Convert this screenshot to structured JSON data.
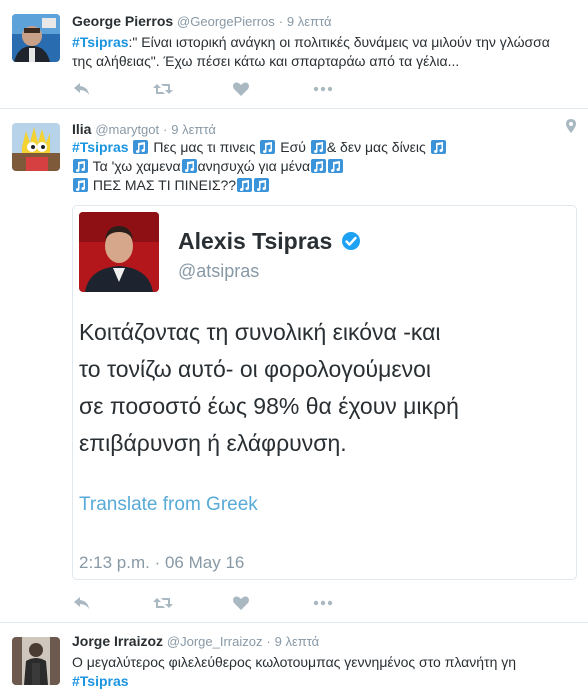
{
  "tweets": [
    {
      "name": "George Pierros",
      "handle": "@GeorgePierros",
      "separator": "·",
      "time": "9 λεπτά",
      "line1_tag": "#Tsipras",
      "line1_rest": ":\" Είναι ιστορική ανάγκη οι πολιτικές δυνάμεις να μιλούν την γλώσσα",
      "line2": "της αλήθειας\". Έχω πέσει κάτω και σπαρταράω από τα γέλια..."
    },
    {
      "name": "Ilia",
      "handle": "@marytgot",
      "separator": "·",
      "time": "9 λεπτά",
      "line1_tag": "#Tsipras",
      "line1_a": "Πες μας τι πινεις",
      "line1_b": "Εσύ",
      "line1_c": "& δεν μας δίνεις",
      "line2": "Τα 'χω χαμενα",
      "line2_b": "ανησυχώ για μένα",
      "line3": "ΠΕΣ ΜΑΣ ΤΙ ΠΙΝΕΙΣ??",
      "quoted": {
        "name": "Alexis Tsipras",
        "handle": "@atsipras",
        "text_lines": [
          "Κοιτάζοντας τη συνολική εικόνα -και",
          "το τονίζω αυτό- οι φορολογούμενοι",
          "σε ποσοστό έως 98% θα έχουν μικρή",
          "επιβάρυνση ή ελάφρυνση."
        ],
        "translate": "Translate from Greek",
        "timestamp": "2:13 p.m. · 06 May 16"
      }
    },
    {
      "name": "Jorge Irraizoz",
      "handle": "@Jorge_Irraizoz",
      "separator": "·",
      "time": "9 λεπτά",
      "line1": "Ο μεγαλύτερος φιλελεύθερος κωλοτουμπας γεννημένος στο πλανήτη γη",
      "line2_tag": "#Tsipras"
    }
  ],
  "icons": {
    "reply": "reply-icon",
    "retweet": "retweet-icon",
    "like": "heart-icon",
    "more": "more-icon",
    "location": "location-icon",
    "music": "music-note-emoji",
    "verified": "verified-badge-icon"
  },
  "colors": {
    "hashtag": "#1b95e0",
    "muted": "#8899a6",
    "action": "#aab8c2",
    "verified": "#1da1f2",
    "music": "#3b94d9"
  }
}
